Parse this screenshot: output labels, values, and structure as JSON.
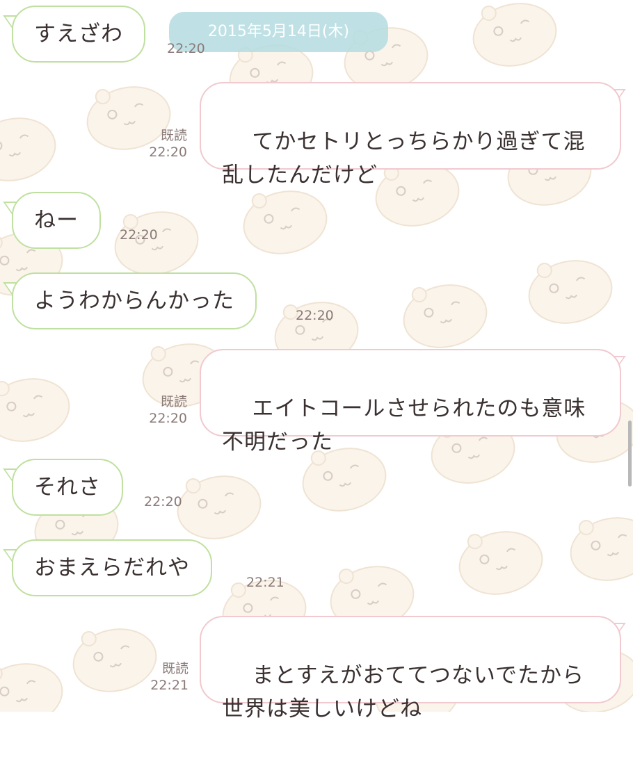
{
  "chat": {
    "date_label": "2015年5月14日(木)",
    "messages": [
      {
        "side": "in",
        "text": "すえざわ",
        "time": "22:20",
        "read": ""
      },
      {
        "side": "out",
        "text": "てかセトリとっちらかり過ぎて混\n乱したんだけど",
        "time": "22:20",
        "read": "既読"
      },
      {
        "side": "in",
        "text": "ねー",
        "time": "22:20",
        "read": ""
      },
      {
        "side": "in",
        "text": "ようわからんかった",
        "time": "22:20",
        "read": ""
      },
      {
        "side": "out",
        "text": "エイトコールさせられたのも意味\n不明だった",
        "time": "22:20",
        "read": "既読"
      },
      {
        "side": "in",
        "text": "それさ",
        "time": "22:20",
        "read": ""
      },
      {
        "side": "in",
        "text": "おまえらだれや",
        "time": "22:21",
        "read": ""
      },
      {
        "side": "out",
        "text": "まとすえがおててつないでたから\n世界は美しいけどね",
        "time": "22:21",
        "read": "既読"
      }
    ]
  },
  "colors": {
    "incoming_border": "#bfe0a0",
    "outgoing_border": "#f1c9cf",
    "date_pill": "#b4dce1",
    "text": "#3a3030",
    "meta_text": "#8a7a78"
  },
  "background": {
    "pattern_icon": "hamster-sticker-icon"
  }
}
